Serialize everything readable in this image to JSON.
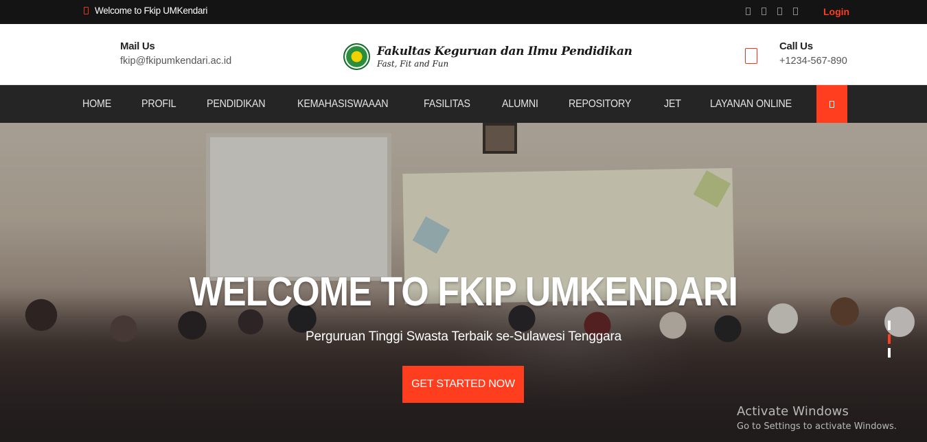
{
  "topbar": {
    "welcome_text": "Welcome to Fkip UMKendari",
    "home_icon": "home-icon",
    "social_icons": [
      "facebook-icon",
      "twitter-icon",
      "instagram-icon",
      "youtube-icon"
    ],
    "login_label": "Login"
  },
  "header": {
    "mail_title": "Mail Us",
    "mail_value": "fkip@fkipumkendari.ac.id",
    "brand_name": "Fakultas Keguruan dan Ilmu Pendidikan",
    "brand_tagline": "Fast, Fit and Fun",
    "call_title": "Call Us",
    "call_value": "+1234-567-890"
  },
  "nav": {
    "items": [
      "HOME",
      "PROFIL",
      "PENDIDIKAN",
      "KEMAHASISWAAAN",
      "FASILITAS",
      "ALUMNI",
      "REPOSITORY",
      "JET",
      "LAYANAN ONLINE"
    ],
    "search_icon": "search-icon"
  },
  "hero": {
    "title": "WELCOME TO FKIP UMKENDARI",
    "subtitle": "Perguruan Tinggi Swasta Terbaik se-Sulawesi Tenggara",
    "cta_label": "GET STARTED NOW",
    "slides": 3,
    "active_slide": 2
  },
  "watermark": {
    "line1": "Activate Windows",
    "line2": "Go to Settings to activate Windows."
  },
  "colors": {
    "accent": "#ff3d1f",
    "topbar_bg": "#141414",
    "nav_bg": "#252525"
  }
}
